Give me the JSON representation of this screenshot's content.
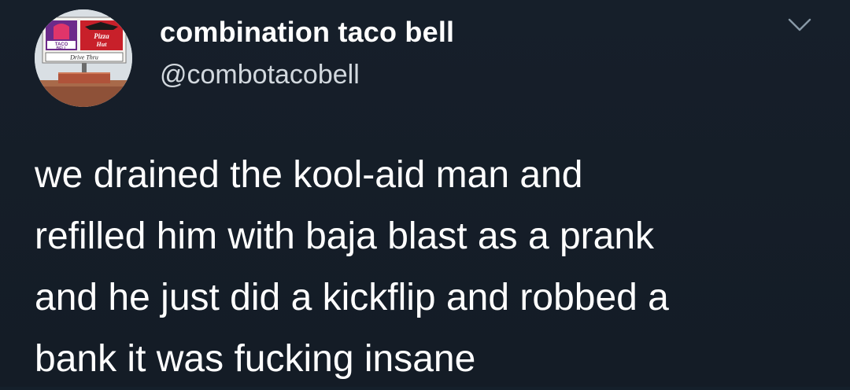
{
  "account": {
    "display_name": "combination taco bell",
    "handle": "@combotacobell",
    "avatar_sign_text": {
      "taco": "TACO",
      "bell": "BELL",
      "pizza": "Pizza",
      "hut": "Hut",
      "drive_thru": "Drive Thru"
    }
  },
  "tweet": {
    "lines": [
      "we drained the kool-aid man and",
      "refilled him with baja blast as a prank",
      "and he just did a kickflip and robbed a",
      "bank it was fucking insane"
    ]
  },
  "icons": {
    "menu": "chevron-down-icon"
  },
  "colors": {
    "background": "#15202b",
    "text_primary": "#ffffff",
    "text_secondary": "#d2d8de",
    "icon": "#8899a6"
  }
}
